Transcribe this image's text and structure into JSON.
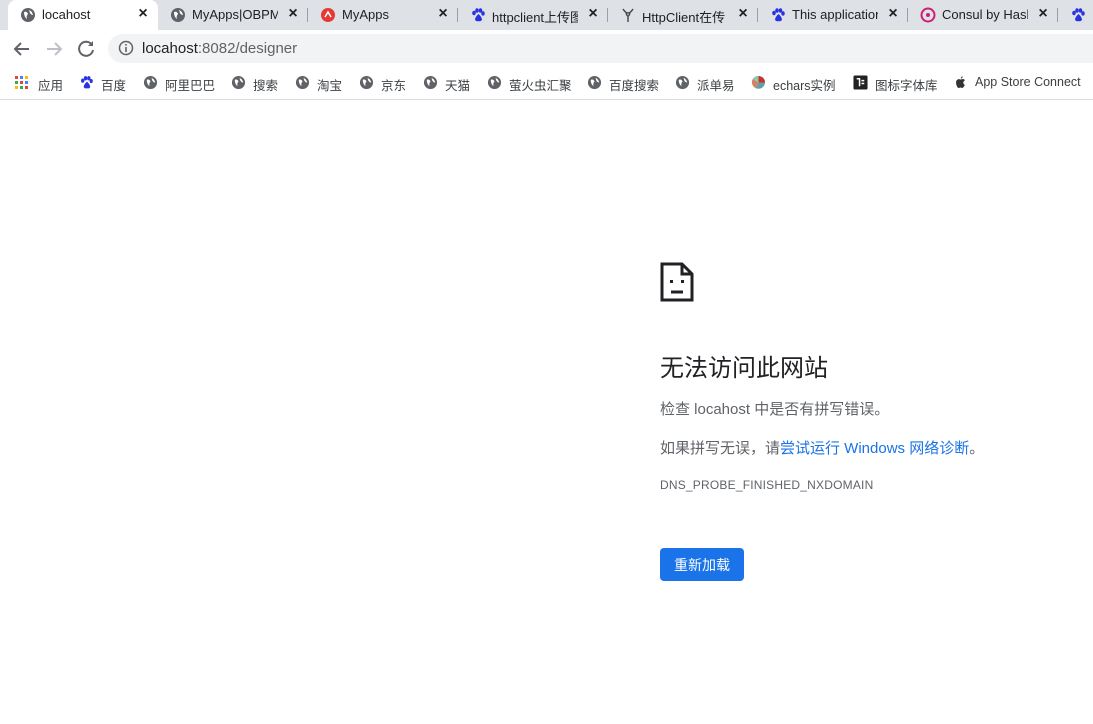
{
  "tabs": [
    {
      "title": "locahost",
      "icon": "globe-icon",
      "active": true
    },
    {
      "title": "MyApps|OBPM",
      "icon": "globe-icon"
    },
    {
      "title": "MyApps",
      "icon": "myapps-logo-icon"
    },
    {
      "title": "httpclient上传图",
      "icon": "baidu-paw-icon"
    },
    {
      "title": "HttpClient在传",
      "icon": "osc-icon"
    },
    {
      "title": "This application",
      "icon": "baidu-paw-icon"
    },
    {
      "title": "Consul by HashiCorp",
      "icon": "consul-icon"
    }
  ],
  "toolbar": {
    "url_host": "locahost",
    "url_path": ":8082/designer"
  },
  "bookmarks": [
    {
      "label": "应用",
      "icon": "apps-grid-icon"
    },
    {
      "label": "百度",
      "icon": "baidu-paw-icon"
    },
    {
      "label": "阿里巴巴",
      "icon": "globe-icon"
    },
    {
      "label": "搜索",
      "icon": "globe-icon"
    },
    {
      "label": "淘宝",
      "icon": "globe-icon"
    },
    {
      "label": "京东",
      "icon": "globe-icon"
    },
    {
      "label": "天猫",
      "icon": "globe-icon"
    },
    {
      "label": "萤火虫汇聚",
      "icon": "globe-icon"
    },
    {
      "label": "百度搜索",
      "icon": "globe-icon"
    },
    {
      "label": "派单易",
      "icon": "globe-icon"
    },
    {
      "label": "echars实例",
      "icon": "echarts-icon"
    },
    {
      "label": "图标字体库",
      "icon": "iconfont-icon"
    },
    {
      "label": "App Store Connect",
      "icon": "apple-icon"
    }
  ],
  "error": {
    "title": "无法访问此网站",
    "line1": "检查 locahost 中是否有拼写错误。",
    "line2_prefix": "如果拼写无误，请",
    "line2_link": "尝试运行 Windows 网络诊断",
    "line2_suffix": "。",
    "code": "DNS_PROBE_FINISHED_NXDOMAIN",
    "reload_label": "重新加载"
  },
  "colors": {
    "accent": "#1a73e8",
    "tabstrip": "#dee1e6"
  }
}
